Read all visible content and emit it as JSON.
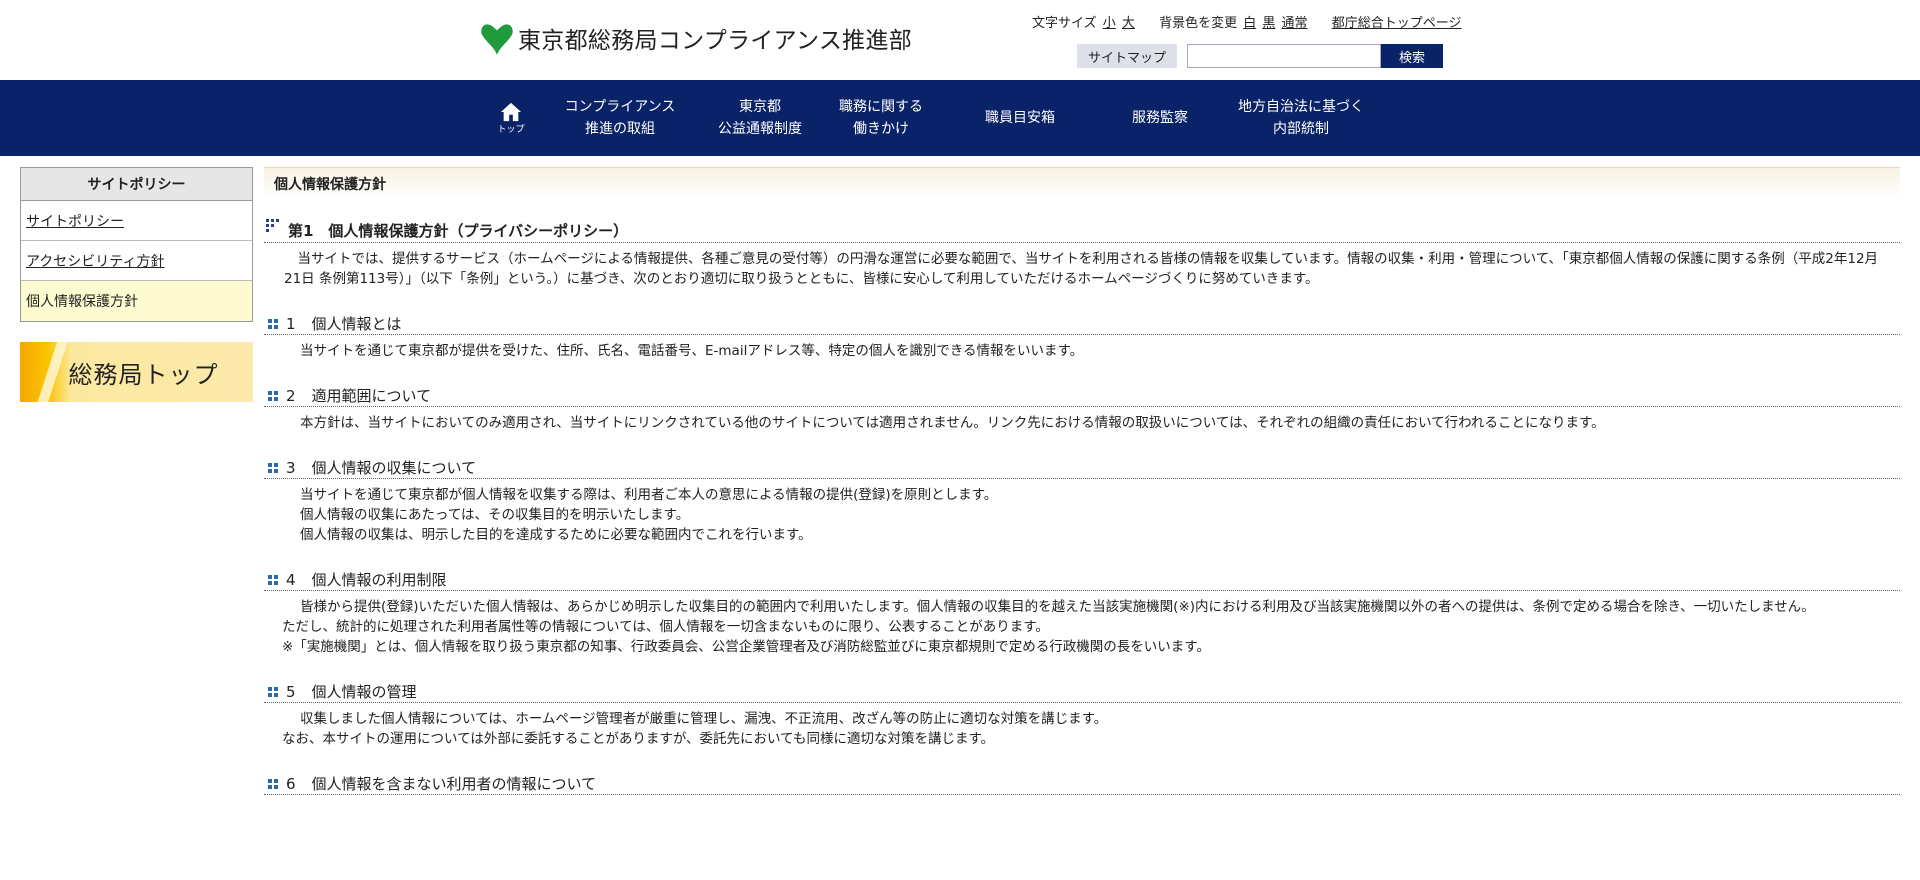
{
  "header": {
    "site_title": "東京都総務局コンプライアンス推進部",
    "util": {
      "font_size_label": "文字サイズ",
      "font_small": "小",
      "font_large": "大",
      "bg_label": "背景色を変更",
      "bg_white": "白",
      "bg_black": "黒",
      "bg_normal": "通常",
      "portal_link": "都庁総合トップページ"
    },
    "sitemap_label": "サイトマップ",
    "search_placeholder": "",
    "search_button": "検索"
  },
  "nav": {
    "home_label": "トップ",
    "items": [
      {
        "line1": "コンプライアンス",
        "line2": "推進の取組"
      },
      {
        "line1": "東京都",
        "line2": "公益通報制度"
      },
      {
        "line1": "職務に関する",
        "line2": "働きかけ"
      },
      {
        "line1": "職員目安箱",
        "line2": ""
      },
      {
        "line1": "服務監察",
        "line2": ""
      },
      {
        "line1": "地方自治法に基づく",
        "line2": "内部統制"
      }
    ]
  },
  "sidebar": {
    "heading": "サイトポリシー",
    "items": [
      {
        "label": "サイトポリシー"
      },
      {
        "label": "アクセシビリティ方針"
      },
      {
        "label": "個人情報保護方針"
      }
    ],
    "banner_text": "総務局トップ"
  },
  "main": {
    "page_title": "個人情報保護方針",
    "heading": "第1　個人情報保護方針（プライバシーポリシー）",
    "lead": "当サイトでは、提供するサービス（ホームページによる情報提供、各種ご意見の受付等）の円滑な運営に必要な範囲で、当サイトを利用される皆様の情報を収集しています。情報の収集・利用・管理について、「東京都個人情報の保護に関する条例（平成2年12月21日 条例第113号）」（以下「条例」という。）に基づき、次のとおり適切に取り扱うとともに、皆様に安心して利用していただけるホームページづくりに努めていきます。",
    "sections": [
      {
        "num": "1",
        "title": "個人情報とは",
        "lines": [
          "当サイトを通じて東京都が提供を受けた、住所、氏名、電話番号、E-mailアドレス等、特定の個人を識別できる情報をいいます。"
        ]
      },
      {
        "num": "2",
        "title": "適用範囲について",
        "lines": [
          "本方針は、当サイトにおいてのみ適用され、当サイトにリンクされている他のサイトについては適用されません。リンク先における情報の取扱いについては、それぞれの組織の責任において行われることになります。"
        ]
      },
      {
        "num": "3",
        "title": "個人情報の収集について",
        "lines": [
          "当サイトを通じて東京都が個人情報を収集する際は、利用者ご本人の意思による情報の提供(登録)を原則とします。",
          "個人情報の収集にあたっては、その収集目的を明示いたします。",
          "個人情報の収集は、明示した目的を達成するために必要な範囲内でこれを行います。"
        ]
      },
      {
        "num": "4",
        "title": "個人情報の利用制限",
        "lines": [
          "皆様から提供(登録)いただいた個人情報は、あらかじめ明示した収集目的の範囲内で利用いたします。個人情報の収集目的を越えた当該実施機関(※)内における利用及び当該実施機関以外の者への提供は、条例で定める場合を除き、一切いたしません。",
          "ただし、統計的に処理された利用者属性等の情報については、個人情報を一切含まないものに限り、公表することがあります。",
          "※「実施機関」とは、個人情報を取り扱う東京都の知事、行政委員会、公営企業管理者及び消防総監並びに東京都規則で定める行政機関の長をいいます。"
        ]
      },
      {
        "num": "5",
        "title": "個人情報の管理",
        "lines": [
          "収集しました個人情報については、ホームページ管理者が厳重に管理し、漏洩、不正流用、改ざん等の防止に適切な対策を講じます。",
          "なお、本サイトの運用については外部に委託することがありますが、委託先においても同様に適切な対策を講じます。"
        ]
      },
      {
        "num": "6",
        "title": "個人情報を含まない利用者の情報について",
        "lines": []
      }
    ]
  },
  "colors": {
    "nav_bg": "#0a2368",
    "search_button_bg": "#0a2368",
    "current_item_bg": "#fffbd0",
    "logo_green": "#1f9a3c"
  }
}
